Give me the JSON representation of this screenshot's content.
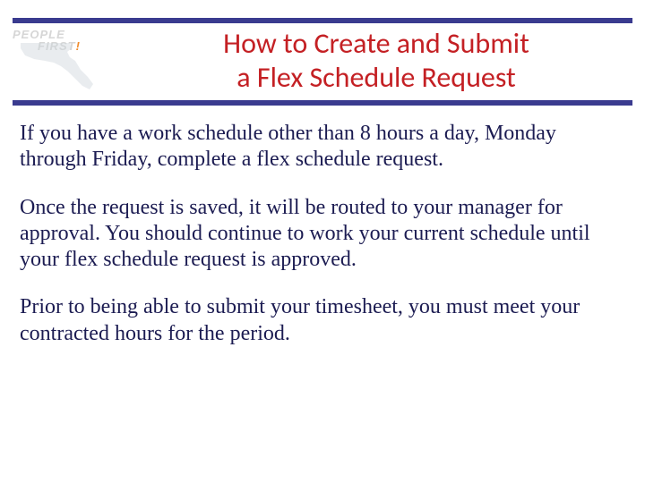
{
  "logo": {
    "line1": "PEOPLE",
    "line2": "FIRST",
    "bang": "!"
  },
  "title": {
    "line1": "How to Create and Submit",
    "line2": "a Flex Schedule Request"
  },
  "body": {
    "p1": "If you have a work schedule other than 8 hours a day, Monday through Friday, complete a flex schedule request.",
    "p2": "Once the request is saved, it will be routed to your manager for approval.  You should continue to work your current schedule until your flex schedule request is approved.",
    "p3": "Prior to being able to submit your timesheet, you must meet your contracted hours for the period."
  }
}
